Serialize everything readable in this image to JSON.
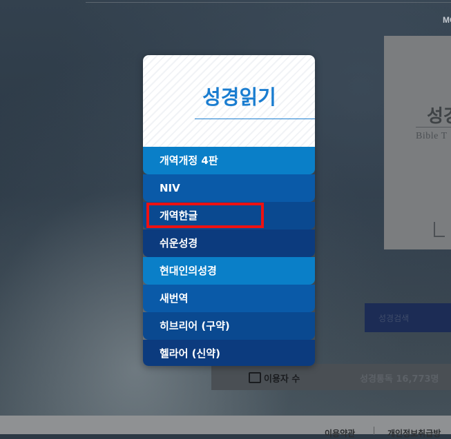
{
  "header": {
    "top_right_text": "MO"
  },
  "right_card": {
    "title": "성경",
    "subtitle": "Bible T"
  },
  "search_button": {
    "label": "성경검색"
  },
  "stats": {
    "users_label": "이용자 수",
    "reads_label": "성경통독 16,773명"
  },
  "footer": {
    "terms": "이용약관",
    "privacy": "개인정보취급방"
  },
  "popup": {
    "title": "성경읽기",
    "items": [
      {
        "label": "개역개정 4판"
      },
      {
        "label": "NIV"
      },
      {
        "label": "개역한글",
        "highlighted": true
      },
      {
        "label": "쉬운성경"
      },
      {
        "label": "현대인의성경"
      },
      {
        "label": "새번역"
      },
      {
        "label": "히브리어 (구약)"
      },
      {
        "label": "헬라어 (신약)"
      }
    ]
  },
  "colors": {
    "title_blue": "#1a7dd0",
    "item_blue_light": "#0a7fc8",
    "item_blue_mid": "#0a5aa8",
    "item_blue_dark": "#0a4990",
    "item_blue_darkest": "#0c3b7e",
    "highlight_red": "#ee1111"
  }
}
